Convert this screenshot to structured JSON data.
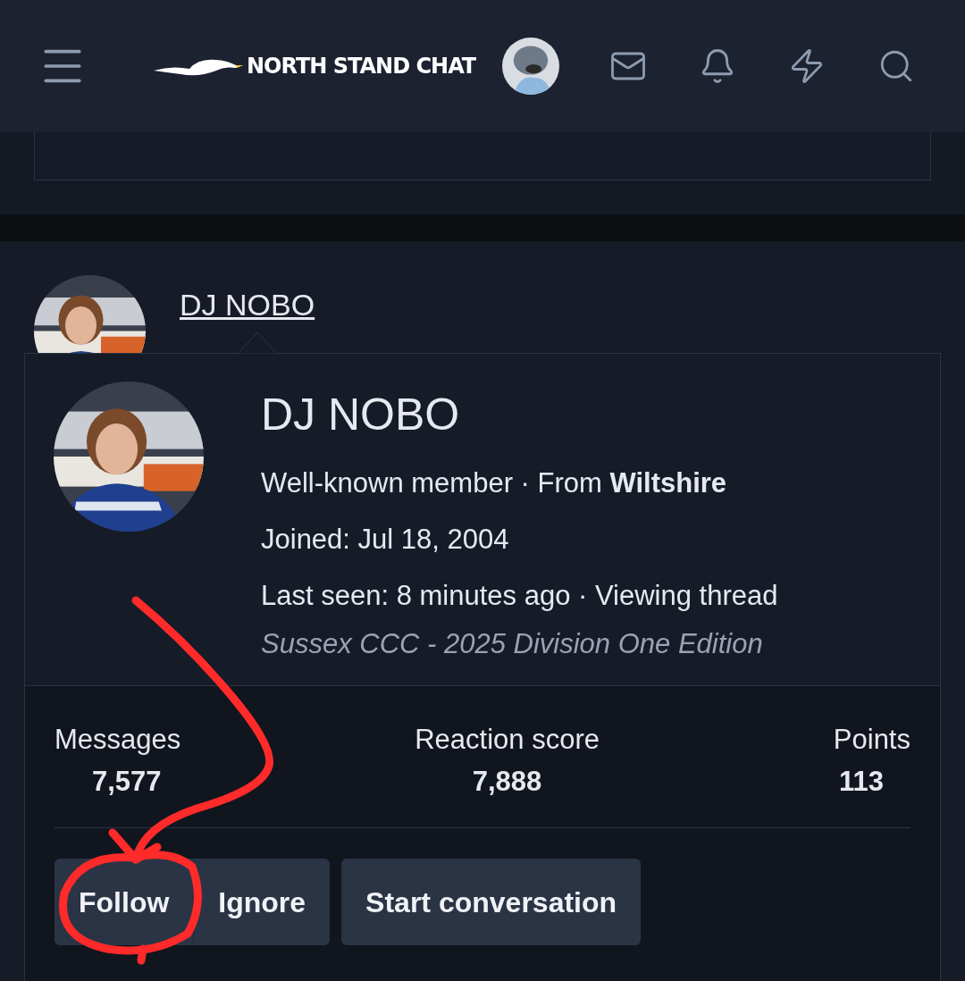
{
  "header": {
    "logo_text": "NORTH STAND CHAT"
  },
  "post": {
    "author": "DJ NOBO"
  },
  "member_card": {
    "name": "DJ NOBO",
    "lines": [
      "Well-known member · From **Wiltshire**",
      "Joined: Jul 18, 2004",
      "Last seen: 8 minutes ago · Viewing thread"
    ],
    "thread_title": "Sussex CCC - 2025 Division One Edition",
    "stats": [
      {
        "label": "Messages",
        "value": "7,577"
      },
      {
        "label": "Reaction score",
        "value": "7,888"
      },
      {
        "label": "Points",
        "value": "113"
      }
    ],
    "button_groups": [
      [
        "Follow",
        "Ignore"
      ],
      [
        "Start conversation"
      ]
    ]
  }
}
